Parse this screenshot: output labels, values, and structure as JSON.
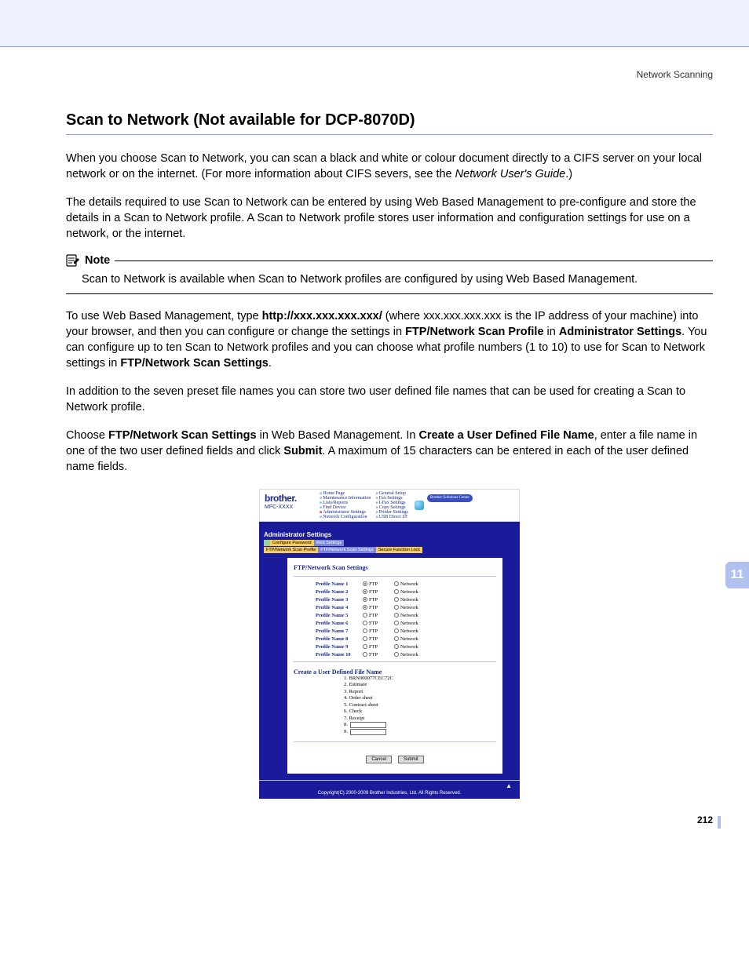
{
  "running_head": "Network Scanning",
  "chapter_tab": "11",
  "page_number": "212",
  "title": "Scan to Network (Not available for DCP-8070D)",
  "p1a": "When you choose Scan to Network, you can scan a black and white or colour document directly to a CIFS server on your local network or on the internet. (For more information about CIFS severs, see the ",
  "p1b_italic": "Network User's Guide",
  "p1c": ".)",
  "p2": "The details required to use Scan to Network can be entered by using Web Based Management to pre-configure and store the details in a Scan to Network profile. A Scan to Network profile stores user information and configuration settings for use on a network, or the internet.",
  "note_label": "Note",
  "note_body": "Scan to Network is available when Scan to Network profiles are configured by using Web Based Management.",
  "p3_a": "To use Web Based Management, type ",
  "p3_b_bold": "http://xxx.xxx.xxx.xxx/",
  "p3_c": " (where xxx.xxx.xxx.xxx is the IP address of your machine) into your browser, and then you can configure or change the settings in ",
  "p3_d_bold": "FTP/Network Scan Profile",
  "p3_e": " in ",
  "p3_f_bold": "Administrator Settings",
  "p3_g": ". You can configure up to ten Scan to Network profiles and you can choose what profile numbers (1 to 10) to use for Scan to Network settings in ",
  "p3_h_bold": "FTP/Network Scan Settings",
  "p3_i": ".",
  "p4": "In addition to the seven preset file names you can store two user defined file names that can be used for creating a Scan to Network profile.",
  "p5_a": "Choose ",
  "p5_b_bold": "FTP/Network Scan Settings",
  "p5_c": " in Web Based Management. In ",
  "p5_d_bold": "Create a User Defined File Name",
  "p5_e": ", enter a file name in one of the two user defined fields and click ",
  "p5_f_bold": "Submit",
  "p5_g": ". A maximum of 15 characters can be entered in each of the user defined name fields.",
  "wbm": {
    "brand": "brother.",
    "model": "MFC-XXXX",
    "bsc": "Brother Solutions Center",
    "links1": [
      "Home Page",
      "Maintenance Information",
      "Lists/Reports",
      "Find Device",
      "Administrator Settings",
      "Network Configuration"
    ],
    "links2": [
      "General Setup",
      "Fax Settings",
      "I-Fax Settings",
      "Copy Settings",
      "Printer Settings",
      "USB Direct I/F"
    ],
    "admin_head": "Administrator Settings",
    "tabs_r1": [
      "",
      "Configure Password",
      "Web Settings"
    ],
    "tabs_r2": [
      "FTP/Network Scan Profile",
      "FTP/Network Scan Settings",
      "Secure Function Lock"
    ],
    "panel_title": "FTP/Network Scan Settings",
    "profiles": [
      {
        "label": "Profile Name 1",
        "sel": "ftp"
      },
      {
        "label": "Profile Name 2",
        "sel": "ftp"
      },
      {
        "label": "Profile Name 3",
        "sel": "ftp"
      },
      {
        "label": "Profile Name 4",
        "sel": "ftp"
      },
      {
        "label": "Profile Name 5",
        "sel": ""
      },
      {
        "label": "Profile Name 6",
        "sel": ""
      },
      {
        "label": "Profile Name 7",
        "sel": ""
      },
      {
        "label": "Profile Name 8",
        "sel": ""
      },
      {
        "label": "Profile Name 9",
        "sel": ""
      },
      {
        "label": "Profile Name 10",
        "sel": ""
      }
    ],
    "opt_ftp": "FTP",
    "opt_net": "Network",
    "panel_title2": "Create a User Defined File Name",
    "fnames": [
      "1.  BRN000077CEC72C",
      "2.  Estimate",
      "3.  Report",
      "4.  Order sheet",
      "5.  Contract sheet",
      "6.  Check",
      "7.  Receipt"
    ],
    "fname8": "8.",
    "fname9": "9.",
    "btn_cancel": "Cancel",
    "btn_submit": "Submit",
    "copyright": "Copyright(C) 2000-2009 Brother Industries, Ltd. All Rights Reserved."
  }
}
